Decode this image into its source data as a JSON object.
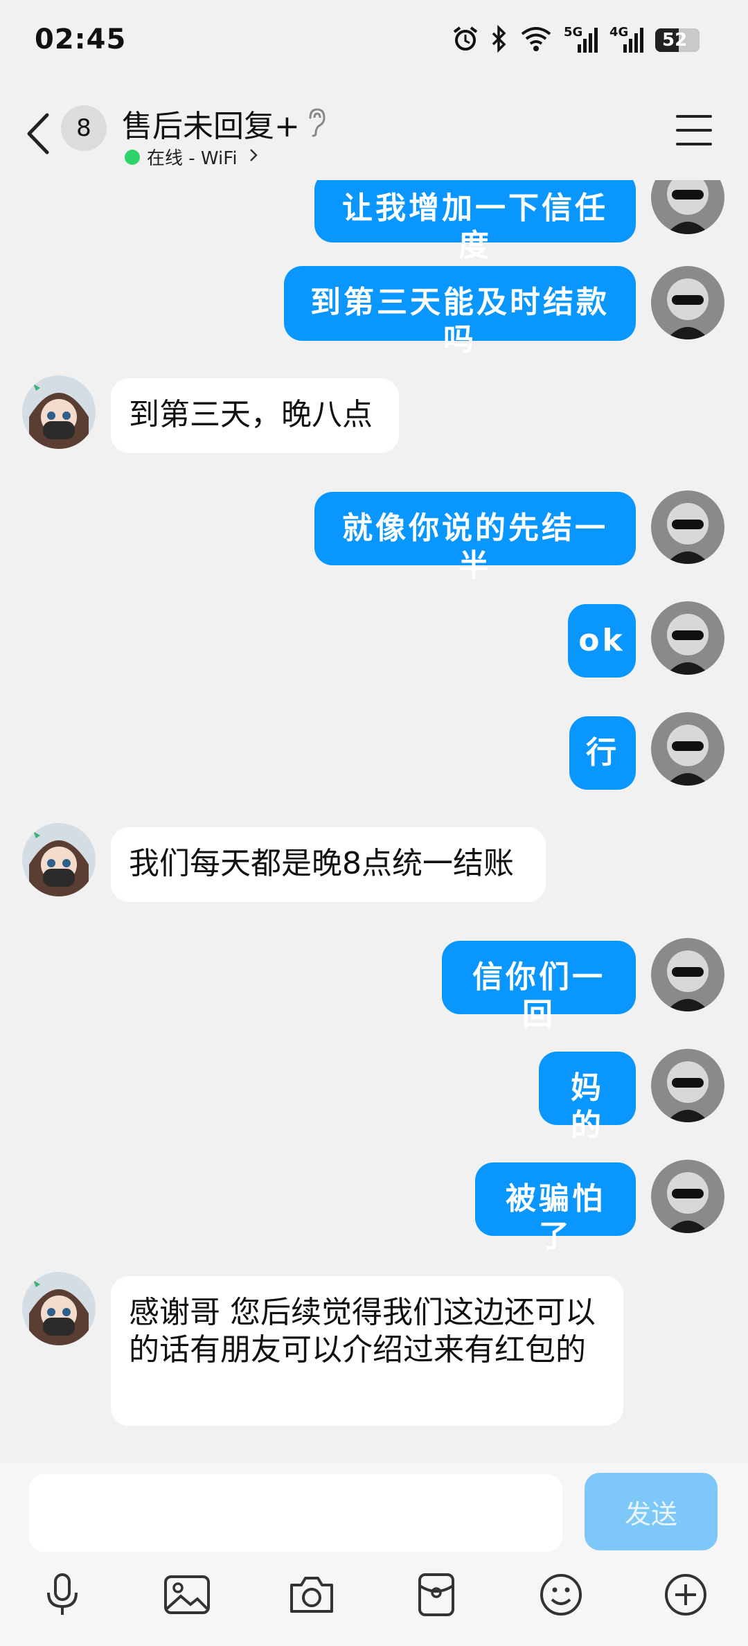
{
  "status_bar": {
    "time": "02:45",
    "net_5g": "5G",
    "net_4g": "4G",
    "battery": "52"
  },
  "header": {
    "unread_count": "8",
    "title": "售后未回复+",
    "online_status": "在线 - WiFi"
  },
  "messages": [
    {
      "from": "me",
      "text": "让我增加一下信任度"
    },
    {
      "from": "me",
      "text": "到第三天能及时结款吗"
    },
    {
      "from": "them",
      "text": "到第三天，晚八点"
    },
    {
      "from": "me",
      "text": "就像你说的先结一半"
    },
    {
      "from": "me",
      "text": "ok"
    },
    {
      "from": "me",
      "text": "行"
    },
    {
      "from": "them",
      "text": "我们每天都是晚8点统一结账"
    },
    {
      "from": "me",
      "text": "信你们一回"
    },
    {
      "from": "me",
      "text": "妈的"
    },
    {
      "from": "me",
      "text": "被骗怕了"
    },
    {
      "from": "them",
      "text": "感谢哥 您后续觉得我们这边还可以的话有朋友可以介绍过来有红包的"
    }
  ],
  "input": {
    "placeholder": "",
    "send_label": "发送"
  },
  "toolbar": [
    "microphone-icon",
    "image-icon",
    "camera-icon",
    "red-packet-icon",
    "emoji-icon",
    "plus-icon"
  ],
  "colors": {
    "my_bubble": "#0996ff",
    "their_bubble": "#ffffff",
    "send_button": "#7ec8f9",
    "online_dot": "#2ed36a"
  }
}
